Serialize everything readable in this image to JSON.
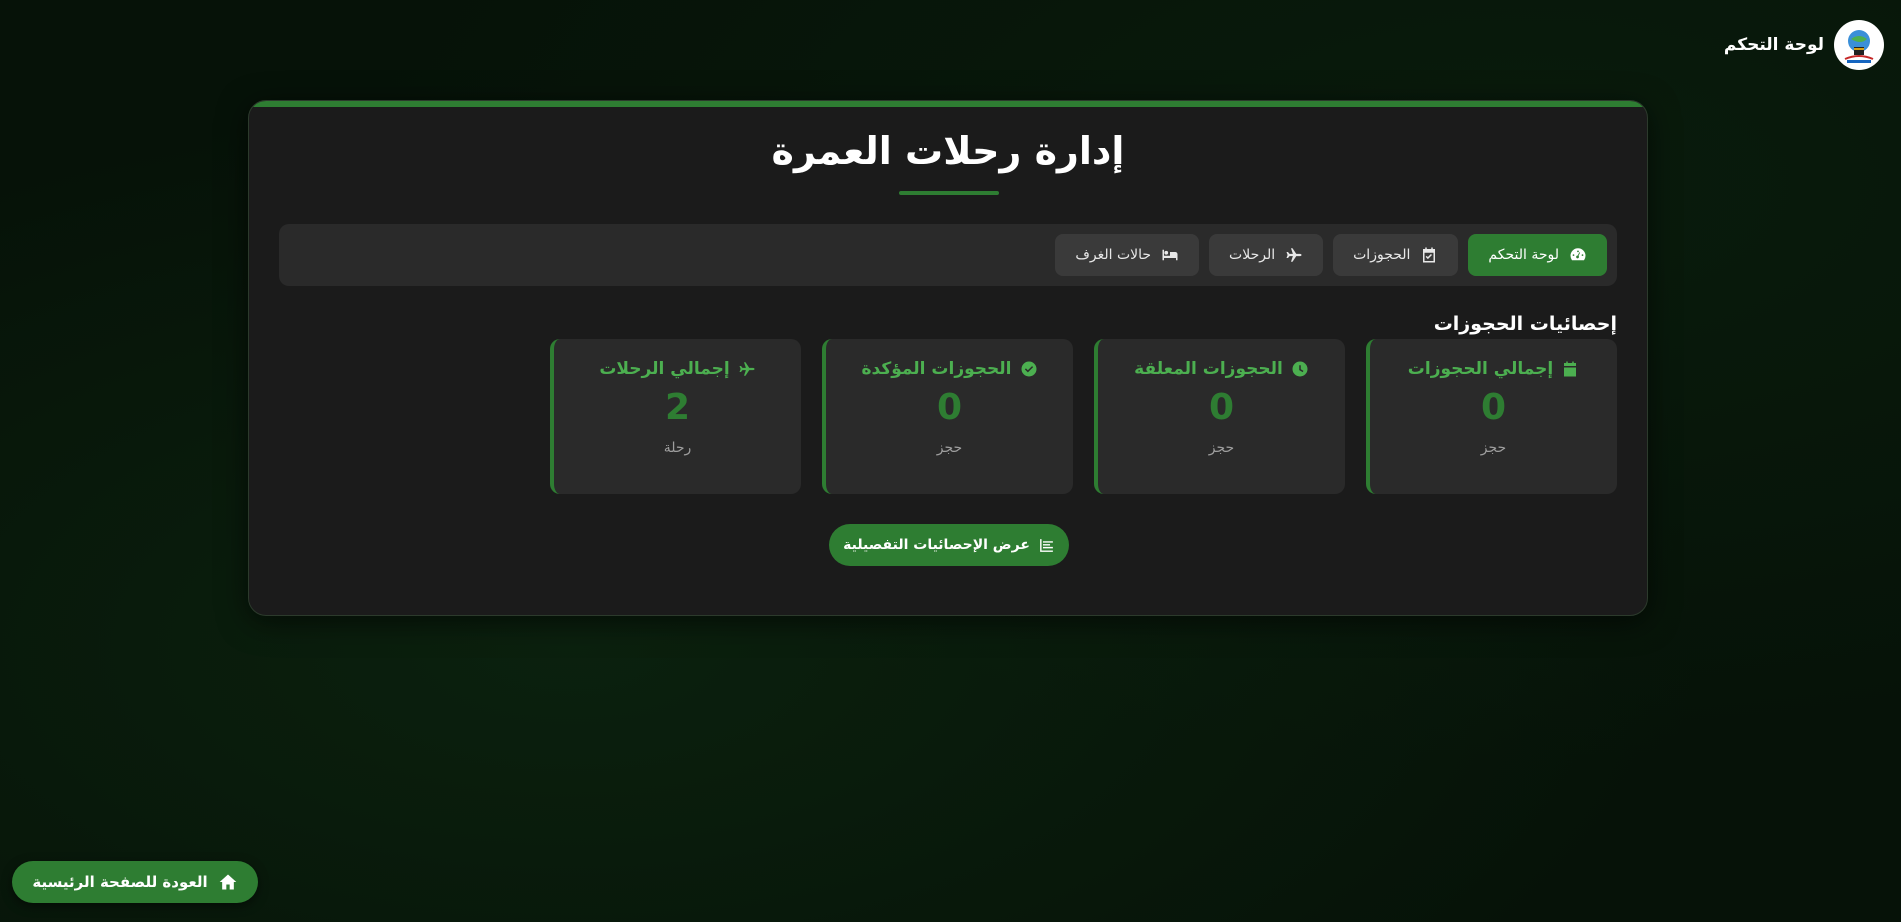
{
  "header": {
    "title": "لوحة التحكم",
    "logo_icon": "kaaba-globe-logo"
  },
  "page": {
    "title": "إدارة رحلات العمرة"
  },
  "nav": {
    "items": [
      {
        "label": "لوحة التحكم",
        "icon": "gauge-icon",
        "active": true
      },
      {
        "label": "الحجوزات",
        "icon": "calendar-check-icon",
        "active": false
      },
      {
        "label": "الرحلات",
        "icon": "plane-icon",
        "active": false
      },
      {
        "label": "حالات الغرف",
        "icon": "bed-icon",
        "active": false
      }
    ]
  },
  "stats": {
    "section_title": "إحصائيات الحجوزات",
    "cards": [
      {
        "title": "إجمالي الحجوزات",
        "icon": "calendar-icon",
        "value": "0",
        "unit": "حجز"
      },
      {
        "title": "الحجوزات المعلقة",
        "icon": "clock-icon",
        "value": "0",
        "unit": "حجز"
      },
      {
        "title": "الحجوزات المؤكدة",
        "icon": "check-circle-icon",
        "value": "0",
        "unit": "حجز"
      },
      {
        "title": "إجمالي الرحلات",
        "icon": "plane-icon",
        "value": "2",
        "unit": "رحلة"
      }
    ],
    "details_button": "عرض الإحصائيات التفصيلية"
  },
  "footer": {
    "home_button": "العودة للصفحة الرئيسية"
  },
  "colors": {
    "accent": "#2e7d32",
    "accent_light": "#4caf50",
    "card_bg": "#1b1b1b",
    "panel_bg": "#2a2a2a"
  }
}
